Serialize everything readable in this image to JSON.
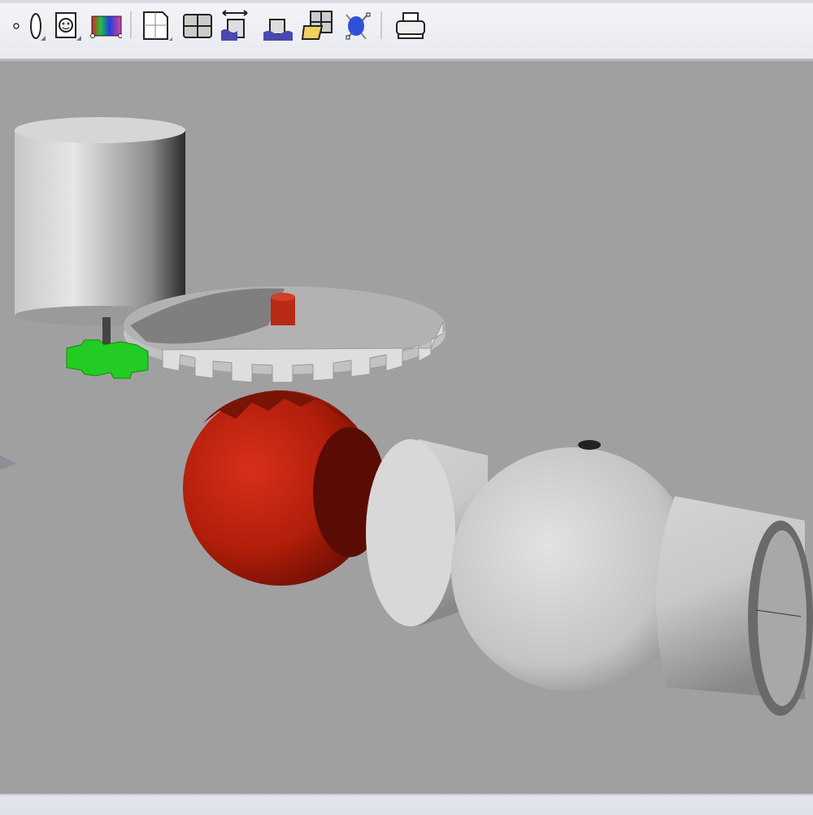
{
  "toolbar": {
    "icons": [
      "point-icon",
      "ellipsoid-icon",
      "render-face-icon",
      "color-gradient-icon",
      "new-layout-icon",
      "four-viewports-icon",
      "stretch-plane-icon",
      "water-plane-icon",
      "open-viewports-icon",
      "camera-target-icon",
      "print-icon"
    ]
  },
  "viewport": {
    "background_color": "#a0a0a0",
    "objects": [
      "cylinder",
      "small-green-gear",
      "large-gear",
      "red-sphere",
      "pipe-ball-joint"
    ]
  },
  "colors": {
    "sphere": "#b8200c",
    "small_gear": "#22cc22",
    "objects": "#d8d8d8"
  }
}
